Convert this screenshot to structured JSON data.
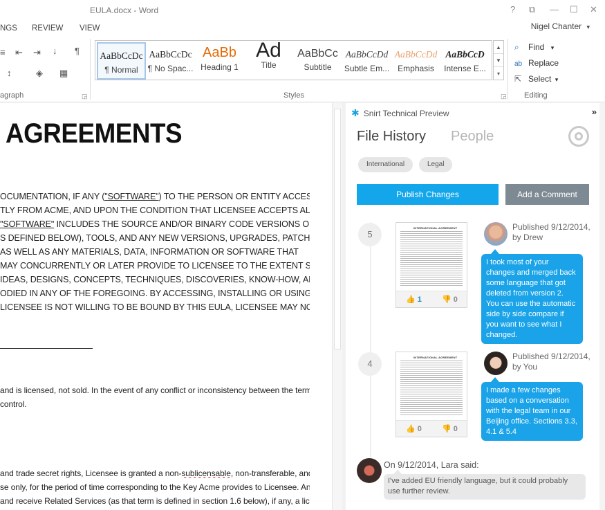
{
  "window": {
    "title": "EULA.docx - Word",
    "controls": [
      "?",
      "⧉",
      "—",
      "☐",
      "✕"
    ]
  },
  "menu": {
    "tabs": [
      "NGS",
      "REVIEW",
      "VIEW"
    ],
    "user": "Nigel Chanter",
    "user_caret": "▾"
  },
  "ribbon": {
    "paragraph_label": "agraph",
    "styles_label": "Styles",
    "editing_label": "Editing",
    "styles": [
      {
        "sample": "AaBbCcDc",
        "name": "¶ Normal"
      },
      {
        "sample": "AaBbCcDc",
        "name": "¶ No Spac..."
      },
      {
        "sample": "AaBb",
        "name": "Heading 1"
      },
      {
        "sample": "Ad",
        "name": "Title"
      },
      {
        "sample": "AaBbCc",
        "name": "Subtitle"
      },
      {
        "sample": "AaBbCcDd",
        "name": "Subtle Em..."
      },
      {
        "sample": "AaBbCcDd",
        "name": "Emphasis"
      },
      {
        "sample": "AaBbCcD",
        "name": "Intense E..."
      }
    ],
    "editing": {
      "find": "Find",
      "find_caret": "▾",
      "replace": "Replace",
      "select": "Select",
      "select_caret": "▾"
    }
  },
  "document": {
    "heading": "AGREEMENTS",
    "p1": [
      "OCUMENTATION, IF ANY (",
      "\"SOFTWARE\"",
      ") TO THE PERSON OR ENTITY ACCESSING",
      "TLY FROM ACME, AND UPON THE CONDITION THAT LICENSEE ACCEPTS ALL OF",
      "\"SOFTWARE\"",
      " INCLUDES THE SOURCE AND/OR BINARY CODE VERSIONS OF THE",
      "S DEFINED BELOW), TOOLS, AND ANY NEW VERSIONS, UPGRADES, PATCHES,",
      "AS WELL AS ANY MATERIALS, DATA, INFORMATION OR SOFTWARE THAT",
      "MAY CONCURRENTLY OR LATER PROVIDE TO LICENSEE TO THE EXTENT SUCH",
      "IDEAS, DESIGNS, CONCEPTS, TECHNIQUES, DISCOVERIES, KNOW-HOW, AND",
      "ODIED IN ANY OF THE FOREGOING. BY ACCESSING, INSTALLING OR USING THE",
      " LICENSEE IS NOT WILLING TO BE BOUND BY THIS EULA, LICENSEE MAY NOT"
    ],
    "p2": [
      "and is licensed, not sold. In the event of any conflict or inconsistency between the terms of",
      "control."
    ],
    "p3": [
      "and trade secret rights, Licensee is granted a non-",
      "sublicensable",
      ", non-transferable, and non-",
      "se only, for the period of time corresponding to the Key Acme provides to Licensee. Any",
      "and receive Related Services (as that term is defined in section 1.6 below), if any, a license"
    ]
  },
  "pane": {
    "header": "Snirt Technical Preview",
    "collapse": "»",
    "tab_active": "File History",
    "tab_inactive": "People",
    "tags": [
      "International",
      "Legal"
    ],
    "publish_button": "Publish Changes",
    "comment_button": "Add a Comment",
    "doc_thumb_title": "INTERNATIONAL AGREEMENT",
    "versions": [
      {
        "number": "5",
        "likes": "1",
        "dislikes": "0",
        "published": "Published 9/12/2014,",
        "by": "by Drew",
        "message": "I took most of your changes and merged back some language that got deleted from version 2. You can use the automatic side by side compare if you want to see what I changed."
      },
      {
        "number": "4",
        "likes": "0",
        "dislikes": "0",
        "published": "Published 9/12/2014,",
        "by": "by You",
        "message": "I made a few changes based on a conversation with the legal team in our Beijing office. Sections 3.3, 4.1 & 5.4"
      }
    ],
    "comment": {
      "said": "On 9/12/2014, Lara said:",
      "text": "I've added EU friendly language, but it could probably use further review."
    }
  },
  "colors": {
    "accent": "#14a6ea",
    "secondary_button": "#7d8a93",
    "heading_orange": "#e36c09"
  }
}
